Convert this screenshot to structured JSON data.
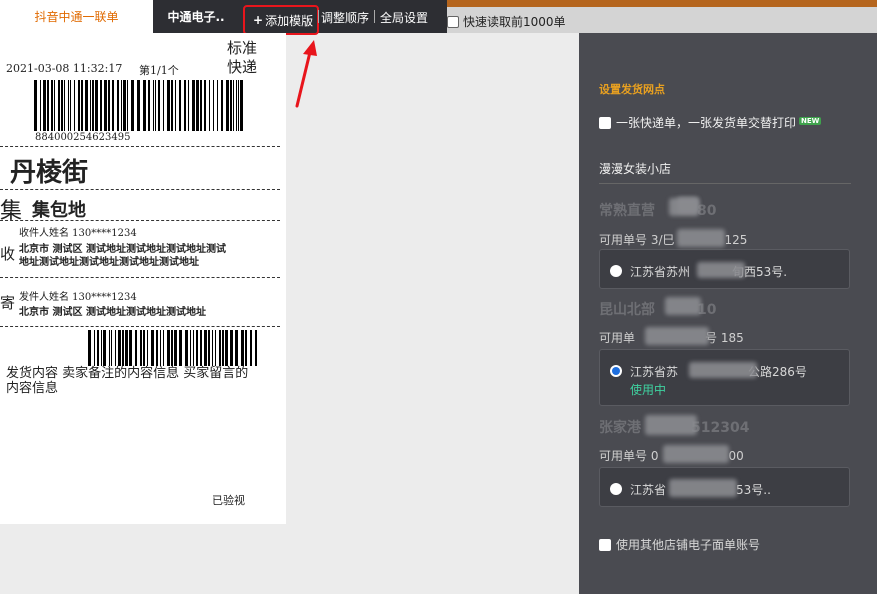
{
  "tabs": {
    "active": "抖音中通一联单",
    "second": "中通电子.."
  },
  "toolbar": {
    "add_template": "添加模版",
    "plus": "+",
    "reorder": "调整顺序",
    "global_settings": "全局设置",
    "fast_read": "快速读取前1000单"
  },
  "label": {
    "datetime": "2021-03-08 11:32:17",
    "page": "第1/1个",
    "service_line1": "标准",
    "service_line2": "快递",
    "tracking_number": "884000254623495",
    "big_mark": "丹棱街",
    "collect_char": "集",
    "collect_text": "集包地",
    "recv_char": "收",
    "recv_name_phone": "收件人姓名   130****1234",
    "recv_addr1": "北京市 测试区 测试地址测试地址测试地址测试",
    "recv_addr2": "地址测试地址测试地址测试地址测试地址",
    "send_char": "寄",
    "send_name_phone": "发件人姓名   130****1234",
    "send_addr": "北京市 测试区 测试地址测试地址测试地址",
    "content_line1": "发货内容 卖家备注的内容信息 买家留言的",
    "content_line2": "内容信息",
    "inspected": "已验视"
  },
  "panel": {
    "section_title": "设置发货网点",
    "alternate_print": "一张快递单，一张发货单交替打印",
    "new_badge": "NEW",
    "shop_name": "漫漫女装小店",
    "outlets": [
      {
        "name_left": "常熟直营",
        "name_right": "80",
        "avail_left": "可用单号 3/巳",
        "avail_right": "125",
        "addr_left": "江苏省苏州",
        "addr_right": "旬西53号.",
        "status": ""
      },
      {
        "name_left": "昆山北部",
        "name_right": "10",
        "avail_left": "可用单",
        "avail_right": "号 185",
        "addr_left": "江苏省苏",
        "addr_right": "公路286号",
        "status": "使用中"
      },
      {
        "name_left": "张家港",
        "name_right": "512304",
        "avail_left": "可用单号 0",
        "avail_right": "00",
        "addr_left": "江苏省",
        "addr_right": "53号..",
        "status": ""
      }
    ],
    "use_other_shop": "使用其他店铺电子面单账号"
  },
  "colors": {
    "accent_orange": "#e8a020",
    "active_green": "#3fd2a0",
    "highlight_red": "#e8151c",
    "radio_blue": "#1e6fe0"
  }
}
